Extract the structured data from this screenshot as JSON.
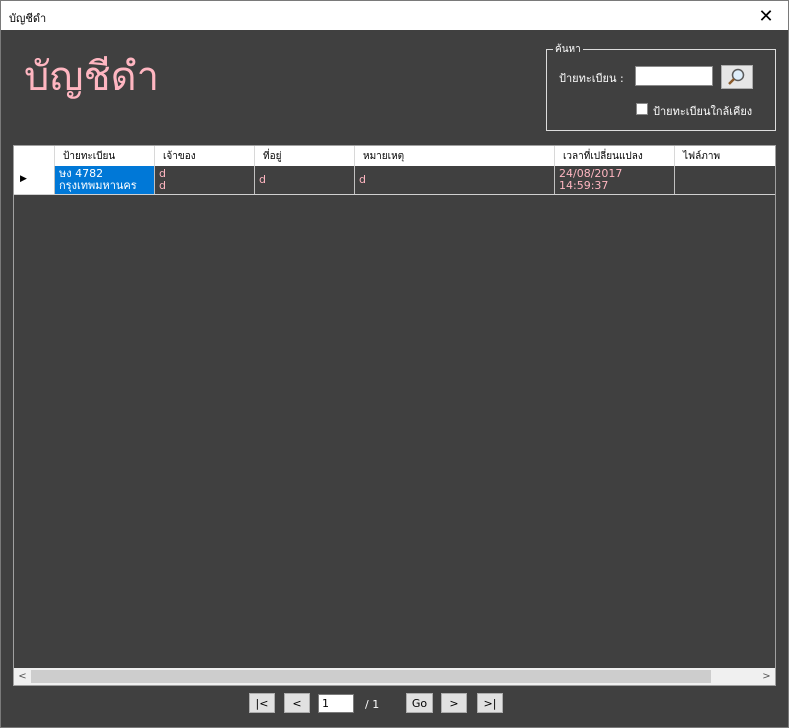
{
  "window": {
    "title": "บัญชีดำ",
    "close_glyph": "✕"
  },
  "heading": "บัญชีดำ",
  "search": {
    "group_label": "ค้นหา",
    "plate_label": "ป้ายทะเบียน :",
    "plate_value": "",
    "nearby_label": "ป้ายทะเบียนใกล้เคียง",
    "nearby_checked": false,
    "button_icon": "magnifier-icon"
  },
  "table": {
    "columns": [
      "ป้ายทะเบียน",
      "เจ้าของ",
      "ที่อยู่",
      "หมายเหตุ",
      "เวลาที่เปลี่ยนแปลง",
      "ไฟล์ภาพ"
    ],
    "rows": [
      {
        "plate_line1": "ษง 4782",
        "plate_line2": "กรุงเทพมหานคร",
        "owner_line1": "d",
        "owner_line2": "d",
        "address": "d",
        "note": "d",
        "changed_date": "24/08/2017",
        "changed_time": "14:59:37",
        "image": ""
      }
    ],
    "row_indicator": "▶"
  },
  "pager": {
    "first": "|<",
    "prev": "<",
    "current_page": "1",
    "total": "/ 1",
    "go": "Go",
    "next": ">",
    "last": ">|"
  },
  "colors": {
    "accent_text": "#ffb6c1",
    "selection": "#0078d7",
    "background": "#404040"
  }
}
